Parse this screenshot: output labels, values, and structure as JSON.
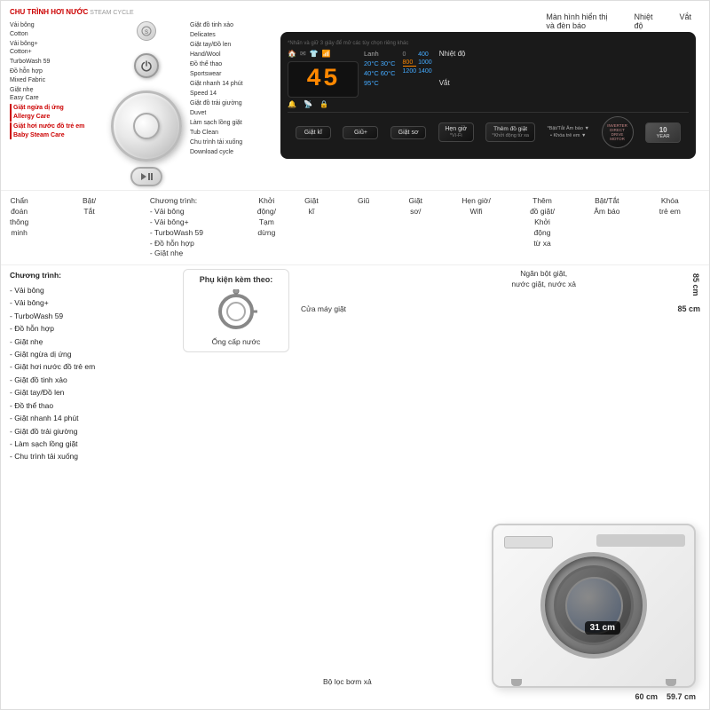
{
  "header": {
    "steam_cycle_label": "CHU TRÌNH HƠI NƯỚC",
    "steam_cycle_en": "STEAM CYCLE"
  },
  "program_list_left": [
    {
      "text": "Vải bông",
      "sub": "Cotton",
      "type": "normal"
    },
    {
      "text": "Vải bông+",
      "sub": "Cotton+",
      "type": "normal"
    },
    {
      "text": "TurboWash 59",
      "sub": "",
      "type": "normal"
    },
    {
      "text": "Đồ hỗn hợp",
      "sub": "Mixed Fabric",
      "type": "normal"
    },
    {
      "text": "Giặt nhẹ",
      "sub": "Easy Care",
      "type": "normal"
    },
    {
      "text": "Giặt ngừa dị ứng",
      "sub": "Allergy Care",
      "type": "highlight"
    },
    {
      "text": "Giặt hơi nước đồ trẻ em",
      "sub": "Baby Steam Care",
      "type": "highlight"
    }
  ],
  "program_list_right": [
    {
      "text": "Giặt đồ tinh xảo",
      "sub": "Delicates"
    },
    {
      "text": "Giặt tay/Đồ len",
      "sub": "Hand/Wool"
    },
    {
      "text": "Đồ thể thao",
      "sub": "Sportswear"
    },
    {
      "text": "Giặt nhanh 14 phút",
      "sub": "Speed 14"
    },
    {
      "text": "Giặt đồ trải giường",
      "sub": "Duvet"
    },
    {
      "text": "Làm sạch lồng giặt",
      "sub": "Tub Clean"
    },
    {
      "text": "Chu trình tải xuống",
      "sub": "Download cycle"
    }
  ],
  "display": {
    "time": "45",
    "temp_label": "Lanh",
    "temp_values": [
      "20°C",
      "30°C",
      "40°C",
      "60°C",
      "95°C"
    ],
    "speed_label_0": "0",
    "speed_values": [
      "400",
      "800",
      "1000",
      "1200",
      "1400"
    ],
    "speed_active": "800",
    "temp_note": "*Nhấn và giữ 3 giây để mở các tùy chọn riêng khác",
    "right_label": "Nhiệt độ",
    "right_label2": "Vắt"
  },
  "buttons": {
    "giat_ki": "Giặt kĩ",
    "giu_plus": "Giũ+",
    "giat_so": "Giặt sơ",
    "hen_gio": "Hẹn giờ",
    "them_do": "Thêm đồ giặt",
    "giat_ki_sub": "",
    "giu_sub": "",
    "giat_so_sub": "Giặt sơ/",
    "hen_gio_sub": "Wifi",
    "them_do_sub": "*Khởi động từ xa",
    "bat_tat": "Bắt/Tắt",
    "am_bao": "Âm báo",
    "khoa": "Khóa",
    "tre_em": "trẻ em",
    "direct_drive": "DIRECT\nDRIVE\nMOTOR",
    "inv": "INVERTER"
  },
  "label_section": {
    "chan_doan": "Chẩn\nđoán\nthông\nminh",
    "bat_tat": "Bật/\nTắt",
    "chuong_trinh": "Chương trình:",
    "khoi_dong": "Khởi\nđộng/\nTạm\ndừng",
    "giat_ki": "Giặt\nkĩ",
    "giu": "Giũ",
    "giat_so": "Giặt\nsơ/",
    "hen_gio_wifi": "Hẹn giờ/\nWifi",
    "them_do_gioi": "Thêm\nđồ giặt/\nKhởi\nđộng\ntừ xa",
    "bat_tat_am_bao": "Bật/Tắt\nÂm báo",
    "khoa_tre_em": "Khóa\ntrẻ em",
    "man_hinh": "Màn hình hiển thị\nvà đèn báo",
    "nhiet_do": "Nhiệt\nđộ",
    "vat": "Vắt"
  },
  "features": {
    "chuong_trinh_label": "Chương trình:",
    "chuong_trinh_items": [
      "- Vải bông",
      "- Vải bông+",
      "- TurboWash 59",
      "- Đồ hỗn hợp",
      "- Giặt nhẹ",
      "- Giặt ngừa dị ứng",
      "- Giặt hơi nước đồ trẻ em",
      "- Giặt đồ tinh xảo",
      "- Giặt tay/Đồ len",
      "- Đồ thể thao",
      "- Giặt nhanh 14 phút",
      "- Giặt đồ trải giường",
      "- Làm sạch lồng giặt",
      "- Chu trình tải xuống"
    ]
  },
  "accessories": {
    "title": "Phụ kiện kèm theo:",
    "hose_label": "Ống cấp nước"
  },
  "machine": {
    "door_label": "Cửa máy giặt",
    "drawer_label": "Ngăn bột giặt,\nnước giặt, nước xả",
    "pump_label": "Bộ lọc bơm xả",
    "size_door": "31 cm",
    "size_width": "60 cm",
    "size_depth": "59.7 cm",
    "size_height": "85 cm"
  }
}
